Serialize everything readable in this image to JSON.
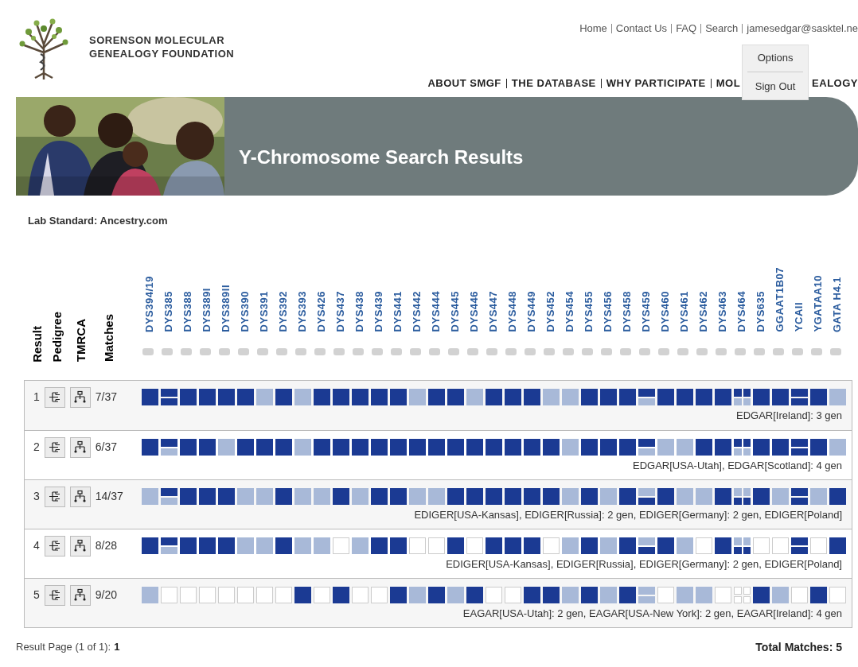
{
  "header": {
    "organization": [
      "SORENSON MOLECULAR",
      "GENEALOGY FOUNDATION"
    ],
    "top_links": [
      "Home",
      "Contact Us",
      "FAQ",
      "Search",
      "jamesedgar@sasktel.ne"
    ],
    "account_menu": [
      "Options",
      "Sign Out"
    ],
    "nav": [
      "ABOUT SMGF",
      "THE DATABASE",
      "WHY PARTICIPATE"
    ],
    "nav_last": {
      "visible_start": "MOL",
      "visible_end": "EALOGY"
    }
  },
  "banner": {
    "title": "Y-Chromosome Search Results"
  },
  "lab_standard": "Lab Standard: Ancestry.com",
  "columns": [
    "Result",
    "Pedigree",
    "TMRCA",
    "Matches"
  ],
  "markers": [
    "DYS394/19",
    "DYS385",
    "DYS388",
    "DYS389I",
    "DYS389II",
    "DYS390",
    "DYS391",
    "DYS392",
    "DYS393",
    "DYS426",
    "DYS437",
    "DYS438",
    "DYS439",
    "DYS441",
    "DYS442",
    "DYS444",
    "DYS445",
    "DYS446",
    "DYS447",
    "DYS448",
    "DYS449",
    "DYS452",
    "DYS454",
    "DYS455",
    "DYS456",
    "DYS458",
    "DYS459",
    "DYS460",
    "DYS461",
    "DYS462",
    "DYS463",
    "DYS464",
    "DYS635",
    "GGAAT1B07",
    "YCAII",
    "YGATAA10",
    "GATA H4.1"
  ],
  "results": [
    {
      "number": "1",
      "matches": "7/37",
      "surnames": "EDGAR[Ireland]: 3 gen",
      "cells": [
        {
          "parts": [
            {
              "color": "#1b3a93"
            }
          ]
        },
        {
          "parts": [
            {
              "color": "#1b3a93"
            },
            {
              "color": "#1b3a93"
            }
          ]
        },
        {
          "parts": [
            {
              "color": "#1b3a93"
            }
          ]
        },
        {
          "parts": [
            {
              "color": "#1b3a93"
            }
          ]
        },
        {
          "parts": [
            {
              "color": "#1b3a93"
            }
          ]
        },
        {
          "parts": [
            {
              "color": "#1b3a93"
            }
          ]
        },
        {
          "parts": [
            {
              "color": "#a8b9d8"
            }
          ]
        },
        {
          "parts": [
            {
              "color": "#1b3a93"
            }
          ]
        },
        {
          "parts": [
            {
              "color": "#a8b9d8"
            }
          ]
        },
        {
          "parts": [
            {
              "color": "#1b3a93"
            }
          ]
        },
        {
          "parts": [
            {
              "color": "#1b3a93"
            }
          ]
        },
        {
          "parts": [
            {
              "color": "#1b3a93"
            }
          ]
        },
        {
          "parts": [
            {
              "color": "#1b3a93"
            }
          ]
        },
        {
          "parts": [
            {
              "color": "#1b3a93"
            }
          ]
        },
        {
          "parts": [
            {
              "color": "#a8b9d8"
            }
          ]
        },
        {
          "parts": [
            {
              "color": "#1b3a93"
            }
          ]
        },
        {
          "parts": [
            {
              "color": "#1b3a93"
            }
          ]
        },
        {
          "parts": [
            {
              "color": "#a8b9d8"
            }
          ]
        },
        {
          "parts": [
            {
              "color": "#1b3a93"
            }
          ]
        },
        {
          "parts": [
            {
              "color": "#1b3a93"
            }
          ]
        },
        {
          "parts": [
            {
              "color": "#1b3a93"
            }
          ]
        },
        {
          "parts": [
            {
              "color": "#a8b9d8"
            }
          ]
        },
        {
          "parts": [
            {
              "color": "#a8b9d8"
            }
          ]
        },
        {
          "parts": [
            {
              "color": "#1b3a93"
            }
          ]
        },
        {
          "parts": [
            {
              "color": "#1b3a93"
            }
          ]
        },
        {
          "parts": [
            {
              "color": "#1b3a93"
            }
          ]
        },
        {
          "parts": [
            {
              "color": "#1b3a93"
            },
            {
              "color": "#a8b9d8"
            }
          ]
        },
        {
          "parts": [
            {
              "color": "#1b3a93"
            }
          ]
        },
        {
          "parts": [
            {
              "color": "#1b3a93"
            }
          ]
        },
        {
          "parts": [
            {
              "color": "#1b3a93"
            }
          ]
        },
        {
          "parts": [
            {
              "color": "#1b3a93"
            }
          ]
        },
        {
          "parts": [
            {
              "color": "#1b3a93"
            },
            {
              "color": "#1b3a93"
            },
            {
              "color": "#a8b9d8"
            },
            {
              "color": "#a8b9d8"
            }
          ]
        },
        {
          "parts": [
            {
              "color": "#1b3a93"
            }
          ]
        },
        {
          "parts": [
            {
              "color": "#1b3a93"
            }
          ]
        },
        {
          "parts": [
            {
              "color": "#1b3a93"
            },
            {
              "color": "#1b3a93"
            }
          ]
        },
        {
          "parts": [
            {
              "color": "#1b3a93"
            }
          ]
        },
        {
          "parts": [
            {
              "color": "#a8b9d8"
            }
          ]
        }
      ]
    },
    {
      "number": "2",
      "matches": "6/37",
      "surnames": "EDGAR[USA-Utah], EDGAR[Scotland]: 4 gen",
      "cells": [
        {
          "parts": [
            {
              "color": "#1b3a93"
            }
          ]
        },
        {
          "parts": [
            {
              "color": "#1b3a93"
            },
            {
              "color": "#a8b9d8"
            }
          ]
        },
        {
          "parts": [
            {
              "color": "#1b3a93"
            }
          ]
        },
        {
          "parts": [
            {
              "color": "#1b3a93"
            }
          ]
        },
        {
          "parts": [
            {
              "color": "#a8b9d8"
            }
          ]
        },
        {
          "parts": [
            {
              "color": "#1b3a93"
            }
          ]
        },
        {
          "parts": [
            {
              "color": "#1b3a93"
            }
          ]
        },
        {
          "parts": [
            {
              "color": "#1b3a93"
            }
          ]
        },
        {
          "parts": [
            {
              "color": "#a8b9d8"
            }
          ]
        },
        {
          "parts": [
            {
              "color": "#1b3a93"
            }
          ]
        },
        {
          "parts": [
            {
              "color": "#1b3a93"
            }
          ]
        },
        {
          "parts": [
            {
              "color": "#1b3a93"
            }
          ]
        },
        {
          "parts": [
            {
              "color": "#1b3a93"
            }
          ]
        },
        {
          "parts": [
            {
              "color": "#1b3a93"
            }
          ]
        },
        {
          "parts": [
            {
              "color": "#1b3a93"
            }
          ]
        },
        {
          "parts": [
            {
              "color": "#1b3a93"
            }
          ]
        },
        {
          "parts": [
            {
              "color": "#1b3a93"
            }
          ]
        },
        {
          "parts": [
            {
              "color": "#1b3a93"
            }
          ]
        },
        {
          "parts": [
            {
              "color": "#1b3a93"
            }
          ]
        },
        {
          "parts": [
            {
              "color": "#1b3a93"
            }
          ]
        },
        {
          "parts": [
            {
              "color": "#1b3a93"
            }
          ]
        },
        {
          "parts": [
            {
              "color": "#1b3a93"
            }
          ]
        },
        {
          "parts": [
            {
              "color": "#a8b9d8"
            }
          ]
        },
        {
          "parts": [
            {
              "color": "#1b3a93"
            }
          ]
        },
        {
          "parts": [
            {
              "color": "#1b3a93"
            }
          ]
        },
        {
          "parts": [
            {
              "color": "#1b3a93"
            }
          ]
        },
        {
          "parts": [
            {
              "color": "#1b3a93"
            },
            {
              "color": "#a8b9d8"
            }
          ]
        },
        {
          "parts": [
            {
              "color": "#a8b9d8"
            }
          ]
        },
        {
          "parts": [
            {
              "color": "#a8b9d8"
            }
          ]
        },
        {
          "parts": [
            {
              "color": "#1b3a93"
            }
          ]
        },
        {
          "parts": [
            {
              "color": "#1b3a93"
            }
          ]
        },
        {
          "parts": [
            {
              "color": "#1b3a93"
            },
            {
              "color": "#1b3a93"
            },
            {
              "color": "#a8b9d8"
            },
            {
              "color": "#a8b9d8"
            }
          ]
        },
        {
          "parts": [
            {
              "color": "#1b3a93"
            }
          ]
        },
        {
          "parts": [
            {
              "color": "#1b3a93"
            }
          ]
        },
        {
          "parts": [
            {
              "color": "#1b3a93"
            },
            {
              "color": "#1b3a93"
            }
          ]
        },
        {
          "parts": [
            {
              "color": "#1b3a93"
            }
          ]
        },
        {
          "parts": [
            {
              "color": "#a8b9d8"
            }
          ]
        }
      ]
    },
    {
      "number": "3",
      "matches": "14/37",
      "surnames": "EDIGER[USA-Kansas], EDIGER[Russia]: 2 gen, EDIGER[Germany]: 2 gen, EDIGER[Poland]",
      "cells": [
        {
          "parts": [
            {
              "color": "#a8b9d8"
            }
          ]
        },
        {
          "parts": [
            {
              "color": "#1b3a93"
            },
            {
              "color": "#a8b9d8"
            }
          ]
        },
        {
          "parts": [
            {
              "color": "#1b3a93"
            }
          ]
        },
        {
          "parts": [
            {
              "color": "#1b3a93"
            }
          ]
        },
        {
          "parts": [
            {
              "color": "#1b3a93"
            }
          ]
        },
        {
          "parts": [
            {
              "color": "#a8b9d8"
            }
          ]
        },
        {
          "parts": [
            {
              "color": "#a8b9d8"
            }
          ]
        },
        {
          "parts": [
            {
              "color": "#1b3a93"
            }
          ]
        },
        {
          "parts": [
            {
              "color": "#a8b9d8"
            }
          ]
        },
        {
          "parts": [
            {
              "color": "#a8b9d8"
            }
          ]
        },
        {
          "parts": [
            {
              "color": "#1b3a93"
            }
          ]
        },
        {
          "parts": [
            {
              "color": "#a8b9d8"
            }
          ]
        },
        {
          "parts": [
            {
              "color": "#1b3a93"
            }
          ]
        },
        {
          "parts": [
            {
              "color": "#1b3a93"
            }
          ]
        },
        {
          "parts": [
            {
              "color": "#a8b9d8"
            }
          ]
        },
        {
          "parts": [
            {
              "color": "#a8b9d8"
            }
          ]
        },
        {
          "parts": [
            {
              "color": "#1b3a93"
            }
          ]
        },
        {
          "parts": [
            {
              "color": "#1b3a93"
            }
          ]
        },
        {
          "parts": [
            {
              "color": "#1b3a93"
            }
          ]
        },
        {
          "parts": [
            {
              "color": "#1b3a93"
            }
          ]
        },
        {
          "parts": [
            {
              "color": "#1b3a93"
            }
          ]
        },
        {
          "parts": [
            {
              "color": "#1b3a93"
            }
          ]
        },
        {
          "parts": [
            {
              "color": "#a8b9d8"
            }
          ]
        },
        {
          "parts": [
            {
              "color": "#1b3a93"
            }
          ]
        },
        {
          "parts": [
            {
              "color": "#a8b9d8"
            }
          ]
        },
        {
          "parts": [
            {
              "color": "#1b3a93"
            }
          ]
        },
        {
          "parts": [
            {
              "color": "#a8b9d8"
            },
            {
              "color": "#1b3a93"
            }
          ]
        },
        {
          "parts": [
            {
              "color": "#1b3a93"
            }
          ]
        },
        {
          "parts": [
            {
              "color": "#a8b9d8"
            }
          ]
        },
        {
          "parts": [
            {
              "color": "#a8b9d8"
            }
          ]
        },
        {
          "parts": [
            {
              "color": "#1b3a93"
            }
          ]
        },
        {
          "parts": [
            {
              "color": "#a8b9d8"
            },
            {
              "color": "#a8b9d8"
            },
            {
              "color": "#1b3a93"
            },
            {
              "color": "#1b3a93"
            }
          ]
        },
        {
          "parts": [
            {
              "color": "#1b3a93"
            }
          ]
        },
        {
          "parts": [
            {
              "color": "#a8b9d8"
            }
          ]
        },
        {
          "parts": [
            {
              "color": "#1b3a93"
            },
            {
              "color": "#1b3a93"
            }
          ]
        },
        {
          "parts": [
            {
              "color": "#a8b9d8"
            }
          ]
        },
        {
          "parts": [
            {
              "color": "#1b3a93"
            }
          ]
        }
      ]
    },
    {
      "number": "4",
      "matches": "8/28",
      "surnames": "EDIGER[USA-Kansas], EDIGER[Russia], EDIGER[Germany]: 2 gen, EDIGER[Poland]",
      "cells": [
        {
          "parts": [
            {
              "color": "#1b3a93"
            }
          ]
        },
        {
          "parts": [
            {
              "color": "#1b3a93"
            },
            {
              "color": "#a8b9d8"
            }
          ]
        },
        {
          "parts": [
            {
              "color": "#1b3a93"
            }
          ]
        },
        {
          "parts": [
            {
              "color": "#1b3a93"
            }
          ]
        },
        {
          "parts": [
            {
              "color": "#1b3a93"
            }
          ]
        },
        {
          "parts": [
            {
              "color": "#a8b9d8"
            }
          ]
        },
        {
          "parts": [
            {
              "color": "#a8b9d8"
            }
          ]
        },
        {
          "parts": [
            {
              "color": "#1b3a93"
            }
          ]
        },
        {
          "parts": [
            {
              "color": "#a8b9d8"
            }
          ]
        },
        {
          "parts": [
            {
              "color": "#a8b9d8"
            }
          ]
        },
        {
          "parts": [
            {
              "color": "#ffffff"
            }
          ]
        },
        {
          "parts": [
            {
              "color": "#a8b9d8"
            }
          ]
        },
        {
          "parts": [
            {
              "color": "#1b3a93"
            }
          ]
        },
        {
          "parts": [
            {
              "color": "#1b3a93"
            }
          ]
        },
        {
          "parts": [
            {
              "color": "#ffffff"
            }
          ]
        },
        {
          "parts": [
            {
              "color": "#ffffff"
            }
          ]
        },
        {
          "parts": [
            {
              "color": "#1b3a93"
            }
          ]
        },
        {
          "parts": [
            {
              "color": "#ffffff"
            }
          ]
        },
        {
          "parts": [
            {
              "color": "#1b3a93"
            }
          ]
        },
        {
          "parts": [
            {
              "color": "#1b3a93"
            }
          ]
        },
        {
          "parts": [
            {
              "color": "#1b3a93"
            }
          ]
        },
        {
          "parts": [
            {
              "color": "#ffffff"
            }
          ]
        },
        {
          "parts": [
            {
              "color": "#a8b9d8"
            }
          ]
        },
        {
          "parts": [
            {
              "color": "#1b3a93"
            }
          ]
        },
        {
          "parts": [
            {
              "color": "#a8b9d8"
            }
          ]
        },
        {
          "parts": [
            {
              "color": "#1b3a93"
            }
          ]
        },
        {
          "parts": [
            {
              "color": "#a8b9d8"
            },
            {
              "color": "#1b3a93"
            }
          ]
        },
        {
          "parts": [
            {
              "color": "#1b3a93"
            }
          ]
        },
        {
          "parts": [
            {
              "color": "#a8b9d8"
            }
          ]
        },
        {
          "parts": [
            {
              "color": "#ffffff"
            }
          ]
        },
        {
          "parts": [
            {
              "color": "#1b3a93"
            }
          ]
        },
        {
          "parts": [
            {
              "color": "#a8b9d8"
            },
            {
              "color": "#a8b9d8"
            },
            {
              "color": "#1b3a93"
            },
            {
              "color": "#1b3a93"
            }
          ]
        },
        {
          "parts": [
            {
              "color": "#ffffff"
            }
          ]
        },
        {
          "parts": [
            {
              "color": "#ffffff"
            }
          ]
        },
        {
          "parts": [
            {
              "color": "#1b3a93"
            },
            {
              "color": "#1b3a93"
            }
          ]
        },
        {
          "parts": [
            {
              "color": "#ffffff"
            }
          ]
        },
        {
          "parts": [
            {
              "color": "#1b3a93"
            }
          ]
        }
      ]
    },
    {
      "number": "5",
      "matches": "9/20",
      "surnames": "EAGAR[USA-Utah]: 2 gen, EAGAR[USA-New York]: 2 gen, EAGAR[Ireland]: 4 gen",
      "cells": [
        {
          "parts": [
            {
              "color": "#a8b9d8"
            }
          ]
        },
        {
          "parts": [
            {
              "color": "#ffffff"
            }
          ]
        },
        {
          "parts": [
            {
              "color": "#ffffff"
            }
          ]
        },
        {
          "parts": [
            {
              "color": "#ffffff"
            }
          ]
        },
        {
          "parts": [
            {
              "color": "#ffffff"
            }
          ]
        },
        {
          "parts": [
            {
              "color": "#ffffff"
            }
          ]
        },
        {
          "parts": [
            {
              "color": "#ffffff"
            }
          ]
        },
        {
          "parts": [
            {
              "color": "#ffffff"
            }
          ]
        },
        {
          "parts": [
            {
              "color": "#1b3a93"
            }
          ]
        },
        {
          "parts": [
            {
              "color": "#ffffff"
            }
          ]
        },
        {
          "parts": [
            {
              "color": "#1b3a93"
            }
          ]
        },
        {
          "parts": [
            {
              "color": "#ffffff"
            }
          ]
        },
        {
          "parts": [
            {
              "color": "#ffffff"
            }
          ]
        },
        {
          "parts": [
            {
              "color": "#1b3a93"
            }
          ]
        },
        {
          "parts": [
            {
              "color": "#a8b9d8"
            }
          ]
        },
        {
          "parts": [
            {
              "color": "#1b3a93"
            }
          ]
        },
        {
          "parts": [
            {
              "color": "#a8b9d8"
            }
          ]
        },
        {
          "parts": [
            {
              "color": "#1b3a93"
            }
          ]
        },
        {
          "parts": [
            {
              "color": "#ffffff"
            }
          ]
        },
        {
          "parts": [
            {
              "color": "#ffffff"
            }
          ]
        },
        {
          "parts": [
            {
              "color": "#1b3a93"
            }
          ]
        },
        {
          "parts": [
            {
              "color": "#1b3a93"
            }
          ]
        },
        {
          "parts": [
            {
              "color": "#a8b9d8"
            }
          ]
        },
        {
          "parts": [
            {
              "color": "#1b3a93"
            }
          ]
        },
        {
          "parts": [
            {
              "color": "#a8b9d8"
            }
          ]
        },
        {
          "parts": [
            {
              "color": "#1b3a93"
            }
          ]
        },
        {
          "parts": [
            {
              "color": "#a8b9d8"
            },
            {
              "color": "#a8b9d8"
            }
          ]
        },
        {
          "parts": [
            {
              "color": "#ffffff"
            }
          ]
        },
        {
          "parts": [
            {
              "color": "#a8b9d8"
            }
          ]
        },
        {
          "parts": [
            {
              "color": "#a8b9d8"
            }
          ]
        },
        {
          "parts": [
            {
              "color": "#ffffff"
            }
          ]
        },
        {
          "parts": [
            {
              "color": "#ffffff"
            },
            {
              "color": "#ffffff"
            },
            {
              "color": "#ffffff"
            },
            {
              "color": "#ffffff"
            }
          ]
        },
        {
          "parts": [
            {
              "color": "#1b3a93"
            }
          ]
        },
        {
          "parts": [
            {
              "color": "#a8b9d8"
            }
          ]
        },
        {
          "parts": [
            {
              "color": "#ffffff"
            }
          ]
        },
        {
          "parts": [
            {
              "color": "#1b3a93"
            }
          ]
        },
        {
          "parts": [
            {
              "color": "#ffffff"
            }
          ]
        }
      ]
    }
  ],
  "footer": {
    "result_page": "Result Page (1 of 1):",
    "page_link": "1",
    "total": "Total Matches: 5"
  }
}
